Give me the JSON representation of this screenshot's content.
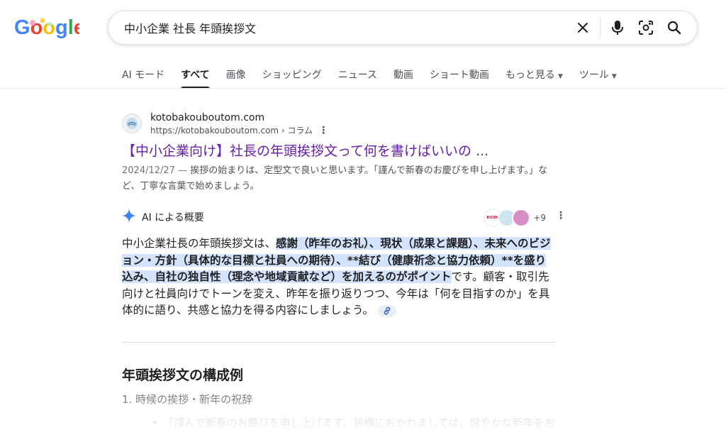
{
  "logo": {
    "text": "Google"
  },
  "search": {
    "query": "中小企業 社長 年頭挨拶文",
    "icons": [
      "close-icon",
      "mic-icon",
      "lens-icon",
      "search-icon"
    ]
  },
  "tabs": [
    {
      "label": "AI モード",
      "active": false
    },
    {
      "label": "すべて",
      "active": true
    },
    {
      "label": "画像",
      "active": false
    },
    {
      "label": "ショッピング",
      "active": false
    },
    {
      "label": "ニュース",
      "active": false
    },
    {
      "label": "動画",
      "active": false
    },
    {
      "label": "ショート動画",
      "active": false
    },
    {
      "label": "もっと見る",
      "active": false,
      "dropdown": true
    },
    {
      "label": "ツール",
      "active": false,
      "dropdown": true
    }
  ],
  "result": {
    "site_name": "kotobakouboutom.com",
    "url": "https://kotobakouboutom.com › コラム",
    "title": "【中小企業向け】社長の年頭挨拶文って何を書けばいいの ...",
    "date": "2024/12/27 —",
    "snippet": " 挨拶の始まりは、定型文で良いと思います。「謹んで新春のお慶びを申し上げます。」など、丁寧な言葉で始めましょう。"
  },
  "ai_overview": {
    "label": "AI による概要",
    "sources_more": "+9",
    "source_badge": "RICOH",
    "body_intro": "中小企業社長の年頭挨拶文は、",
    "body_highlight": "感謝（昨年のお礼）、現状（成果と課題）、未来へのビジョン・方針（具体的な目標と社員への期待）、**結び（健康祈念と協力依頼）**を盛り込み、自社の独自性（理念や地域貢献など）を加えるのがポイント",
    "body_rest": "です。顧客・取引先向けと社員向けでトーンを変え、昨年を振り返りつつ、今年は「何を目指すのか」を具体的に語り、共感と協力を得る内容にしましょう。"
  },
  "section": {
    "title": "年頭挨拶文の構成例",
    "list_item": "1. 時候の挨拶・新年の祝辞",
    "bullet": "「謹んで新春のお慶びを申し上げます。皆様におかれましては、健やかな新年をお"
  }
}
